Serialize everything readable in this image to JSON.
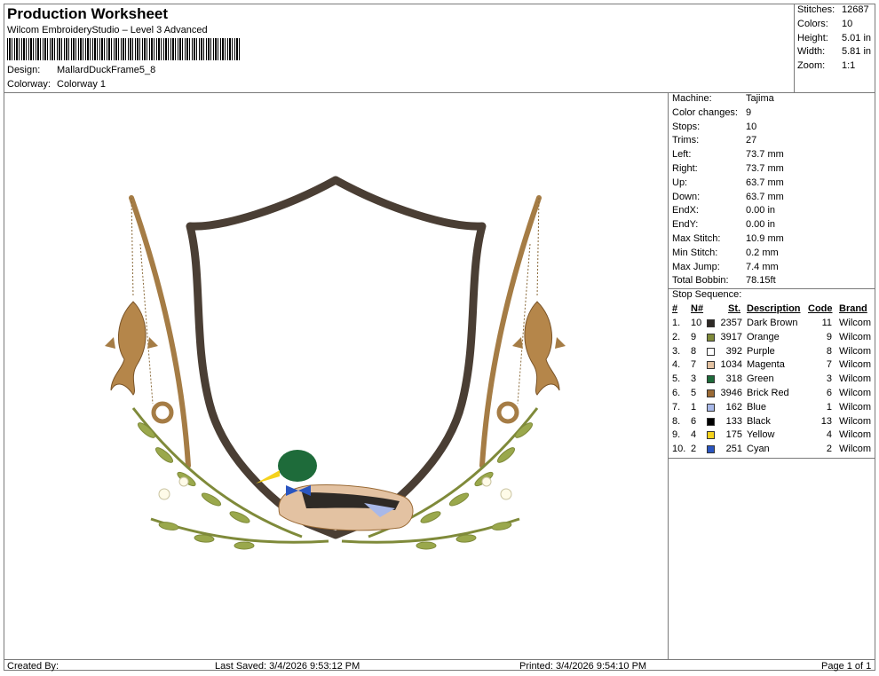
{
  "header": {
    "title": "Production Worksheet",
    "subtitle": "Wilcom EmbroideryStudio – Level 3 Advanced",
    "design_label": "Design:",
    "design_value": "MallardDuckFrame5_8",
    "colorway_label": "Colorway:",
    "colorway_value": "Colorway 1"
  },
  "stats": [
    {
      "label": "Stitches:",
      "value": "12687"
    },
    {
      "label": "Colors:",
      "value": "10"
    },
    {
      "label": "Height:",
      "value": "5.01 in"
    },
    {
      "label": "Width:",
      "value": "5.81 in"
    },
    {
      "label": "Zoom:",
      "value": "1:1"
    }
  ],
  "machine_info": [
    {
      "label": "Machine:",
      "value": "Tajima"
    },
    {
      "label": "Color changes:",
      "value": "9"
    },
    {
      "label": "Stops:",
      "value": "10"
    },
    {
      "label": "Trims:",
      "value": "27"
    },
    {
      "label": "Left:",
      "value": "73.7 mm"
    },
    {
      "label": "Right:",
      "value": "73.7 mm"
    },
    {
      "label": "Up:",
      "value": "63.7 mm"
    },
    {
      "label": "Down:",
      "value": "63.7 mm"
    },
    {
      "label": "EndX:",
      "value": "0.00 in"
    },
    {
      "label": "EndY:",
      "value": "0.00 in"
    },
    {
      "label": "Max Stitch:",
      "value": "10.9 mm"
    },
    {
      "label": "Min Stitch:",
      "value": "0.2 mm"
    },
    {
      "label": "Max Jump:",
      "value": "7.4 mm"
    },
    {
      "label": "Total Bobbin:",
      "value": "78.15ft"
    }
  ],
  "stop_sequence": {
    "title": "Stop Sequence:",
    "headers": {
      "num": "#",
      "n": "N#",
      "st": "St.",
      "desc": "Description",
      "code": "Code",
      "brand": "Brand"
    },
    "rows": [
      {
        "num": "1.",
        "n": "10",
        "color": "#2e2a26",
        "st": "2357",
        "desc": "Dark Brown",
        "code": "11",
        "brand": "Wilcom"
      },
      {
        "num": "2.",
        "n": "9",
        "color": "#7f8a3a",
        "st": "3917",
        "desc": "Orange",
        "code": "9",
        "brand": "Wilcom"
      },
      {
        "num": "3.",
        "n": "8",
        "color": "#ffffff",
        "st": "392",
        "desc": "Purple",
        "code": "8",
        "brand": "Wilcom"
      },
      {
        "num": "4.",
        "n": "7",
        "color": "#e3c2a2",
        "st": "1034",
        "desc": "Magenta",
        "code": "7",
        "brand": "Wilcom"
      },
      {
        "num": "5.",
        "n": "3",
        "color": "#1e6b3a",
        "st": "318",
        "desc": "Green",
        "code": "3",
        "brand": "Wilcom"
      },
      {
        "num": "6.",
        "n": "5",
        "color": "#9a6a35",
        "st": "3946",
        "desc": "Brick Red",
        "code": "6",
        "brand": "Wilcom"
      },
      {
        "num": "7.",
        "n": "1",
        "color": "#a8b8e8",
        "st": "162",
        "desc": "Blue",
        "code": "1",
        "brand": "Wilcom"
      },
      {
        "num": "8.",
        "n": "6",
        "color": "#000000",
        "st": "133",
        "desc": "Black",
        "code": "13",
        "brand": "Wilcom"
      },
      {
        "num": "9.",
        "n": "4",
        "color": "#f5d21c",
        "st": "175",
        "desc": "Yellow",
        "code": "4",
        "brand": "Wilcom"
      },
      {
        "num": "10.",
        "n": "2",
        "color": "#2a55c0",
        "st": "251",
        "desc": "Cyan",
        "code": "2",
        "brand": "Wilcom"
      }
    ]
  },
  "footer": {
    "created_by": "Created By:",
    "last_saved": "Last Saved: 3/4/2026 9:53:12 PM",
    "printed": "Printed: 3/4/2026 9:54:10 PM",
    "page": "Page 1 of 1"
  }
}
